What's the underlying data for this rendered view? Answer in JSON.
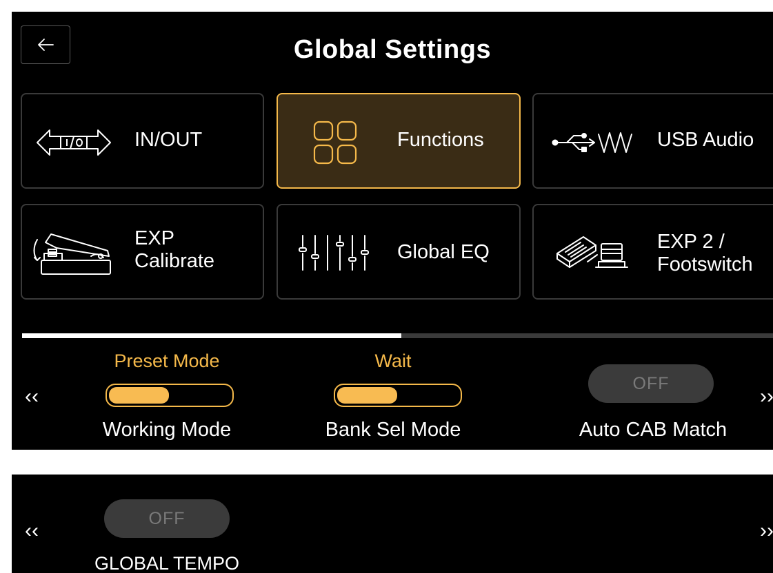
{
  "header": {
    "title": "Global Settings",
    "back_icon": "arrow-left-icon"
  },
  "tiles": [
    {
      "label": "IN/OUT",
      "icon": "in-out-arrows-icon",
      "active": false
    },
    {
      "label": "Functions",
      "icon": "four-squares-grid-icon",
      "active": true
    },
    {
      "label": "USB Audio",
      "icon": "usb-waveform-icon",
      "active": false
    },
    {
      "label": "EXP\nCalibrate",
      "icon": "expression-pedal-icon",
      "active": false
    },
    {
      "label": "Global EQ",
      "icon": "eq-sliders-icon",
      "active": false
    },
    {
      "label": "EXP 2 /\nFootswitch",
      "icon": "pedal-footswitch-icon",
      "active": false
    }
  ],
  "page_progress": 0.5,
  "options_page_1": {
    "prev_arrow": "‹‹",
    "next_arrow": "››",
    "working_mode": {
      "value": "Preset Mode",
      "name": "Working Mode",
      "level": 0.5
    },
    "bank_sel_mode": {
      "value": "Wait",
      "name": "Bank Sel Mode",
      "level": 0.5
    },
    "auto_cab_match": {
      "value": "OFF",
      "name": "Auto CAB Match"
    }
  },
  "options_page_2": {
    "prev_arrow": "‹‹",
    "next_arrow": "››",
    "global_tempo": {
      "value": "OFF",
      "name": "GLOBAL TEMPO"
    }
  },
  "colors": {
    "accent": "#f5b94a",
    "active_tile_bg": "#3a2c15",
    "tile_border": "#3a3a3a",
    "off_pill": "#3b3b3b"
  }
}
